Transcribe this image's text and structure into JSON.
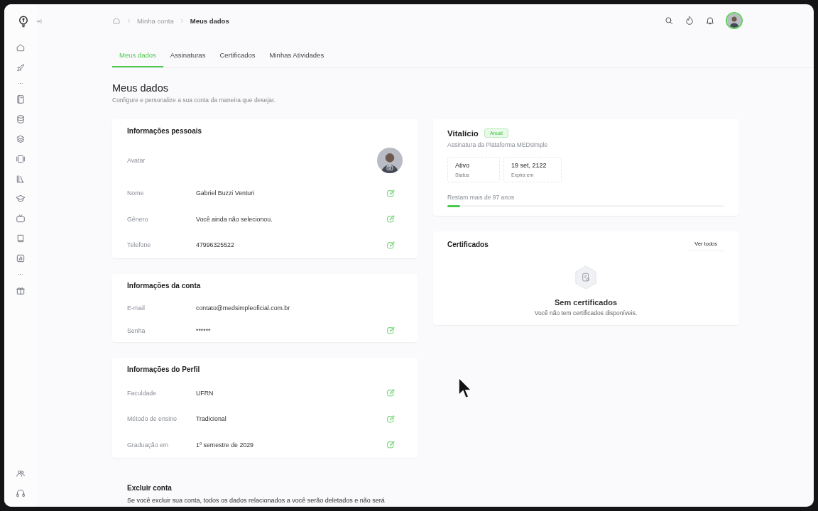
{
  "sidebar": {
    "top_items": [
      {
        "kind": "icon",
        "selected": false
      },
      {
        "kind": "icon",
        "selected": false
      },
      {
        "kind": "separator"
      },
      {
        "kind": "icon",
        "selected": false
      },
      {
        "kind": "icon",
        "selected": false
      },
      {
        "kind": "icon",
        "selected": false
      },
      {
        "kind": "icon",
        "selected": false
      },
      {
        "kind": "icon",
        "selected": false
      },
      {
        "kind": "icon",
        "selected": false
      },
      {
        "kind": "icon",
        "selected": false
      },
      {
        "kind": "icon",
        "selected": false
      },
      {
        "kind": "icon",
        "selected": false
      },
      {
        "kind": "separator"
      },
      {
        "kind": "icon",
        "selected": false
      }
    ],
    "bottom_items": [
      {
        "kind": "icon",
        "selected": false
      },
      {
        "kind": "icon",
        "selected": false
      }
    ]
  },
  "breadcrumb": [
    "Minha conta",
    "Meus dados"
  ],
  "tabs": [
    {
      "label": "Meus dados",
      "selected": true
    },
    {
      "label": "Assinaturas",
      "selected": false
    },
    {
      "label": "Certificados",
      "selected": false
    },
    {
      "label": "Minhas Atividades",
      "selected": false
    }
  ],
  "page": {
    "title": "Meus dados",
    "subtitle": "Configure e personalize a sua conta da maneira que desejar."
  },
  "sections": [
    {
      "title": "Informações pessoais",
      "rows": [
        {
          "kind": "avatar",
          "label": "Avatar"
        },
        {
          "kind": "field",
          "label": "Nome",
          "value": "Gabriel Buzzi Venturi",
          "editable": true
        },
        {
          "kind": "field",
          "label": "Gênero",
          "value": "Você ainda não selecionou.",
          "editable": true
        },
        {
          "kind": "field",
          "label": "Telefone",
          "value": "47996325522",
          "editable": true
        }
      ]
    },
    {
      "title": "Informações da conta",
      "rows": [
        {
          "kind": "field",
          "label": "E-mail",
          "value": "contato@medsimpleoficial.com.br",
          "editable": false
        },
        {
          "kind": "field",
          "label": "Senha",
          "value": "******",
          "editable": true
        }
      ]
    },
    {
      "title": "Informações do Perfil",
      "rows": [
        {
          "kind": "field",
          "label": "Faculdade",
          "value": "UFRN",
          "editable": true
        },
        {
          "kind": "field",
          "label": "Método de ensino",
          "value": "Tradicional",
          "editable": true
        },
        {
          "kind": "field",
          "label": "Graduação em",
          "value": "1º semestre de 2029",
          "editable": true
        }
      ]
    }
  ],
  "delete_account": {
    "title": "Excluir conta",
    "text": "Se você excluir sua conta, todos os dados relacionados a você serão deletados e não será"
  },
  "subscription": {
    "title": "Vitalício",
    "badge": "Anual",
    "subtitle": "Assinatura da Plataforma MEDsimple",
    "stats": [
      {
        "value": "Ativo",
        "label": "Status"
      },
      {
        "value": "19 set, 2122",
        "label": "Expira em"
      }
    ],
    "remaining": "Restam mais de 97 anos",
    "level": 0.045
  },
  "certificates": {
    "title": "Certificados",
    "button": "Ver todos",
    "empty_title": "Sem certificados",
    "empty_text": "Você não tem certificados disponíveis."
  }
}
